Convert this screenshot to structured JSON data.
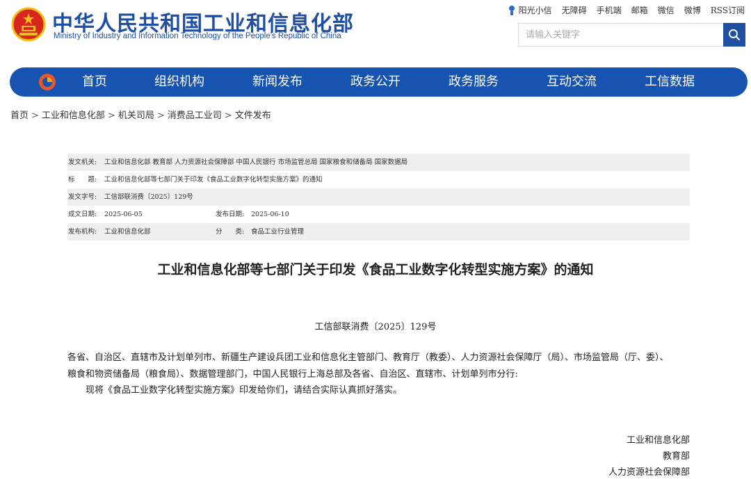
{
  "header": {
    "title_cn": "中华人民共和国工业和信息化部",
    "title_en": "Ministry of Industry and Information Technology of the People's Republic of China",
    "top_links": [
      "阳光小信",
      "无障碍",
      "手机端",
      "邮箱",
      "微信",
      "微博",
      "RSS订阅"
    ],
    "search_placeholder": "请输入关键字"
  },
  "nav": {
    "items": [
      "首页",
      "组织机构",
      "新闻发布",
      "政务公开",
      "政务服务",
      "互动交流",
      "工信数据"
    ]
  },
  "breadcrumb": [
    "首页",
    "工业和信息化部",
    "机关司局",
    "消费品工业司",
    "文件发布"
  ],
  "meta": {
    "issuer_label": "发文机关:",
    "issuer_value": "工业和信息化部 教育部 人力资源社会保障部 中国人民银行 市场监管总局 国家粮食和储备局 国家数据局",
    "title_label": "标　　题:",
    "title_value": "工业和信息化部等七部门关于印发《食品工业数字化转型实施方案》的通知",
    "docno_label": "发文字号:",
    "docno_value": "工信部联消费〔2025〕129号",
    "written_label": "成文日期:",
    "written_value": "2025-06-05",
    "published_label": "发布日期:",
    "published_value": "2025-06-10",
    "org_label": "发布机构:",
    "org_value": "工业和信息化部",
    "category_label": "分　　类:",
    "category_value": "食品工业行业管理"
  },
  "article": {
    "title": "工业和信息化部等七部门关于印发《食品工业数字化转型实施方案》的通知",
    "doc_number": "工信部联消费〔2025〕129号",
    "recipients": "各省、自治区、直辖市及计划单列市、新疆生产建设兵团工业和信息化主管部门、教育厅（教委）、人力资源社会保障厅（局）、市场监管局（厅、委）、粮食和物资储备局（粮食局）、数据管理部门，中国人民银行上海总部及各省、自治区、直辖市、计划单列市分行:",
    "body": "现将《食品工业数字化转型实施方案》印发给你们，请结合实际认真抓好落实。",
    "signatories": [
      "工业和信息化部",
      "教育部",
      "人力资源社会保障部"
    ]
  },
  "colors": {
    "brand_blue": "#1e4fa3",
    "nav_blue": "#1753b0",
    "meta_shade": "#efefef"
  }
}
